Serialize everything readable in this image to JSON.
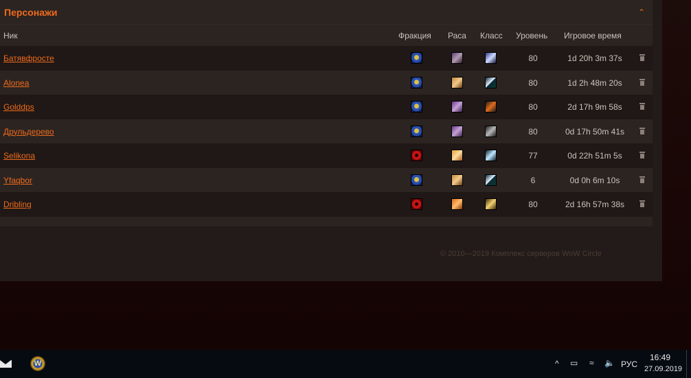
{
  "panel": {
    "title": "Персонажи",
    "collapse_icon": "chevron-up-icon",
    "accent_color": "#ef6a1c"
  },
  "table": {
    "columns": {
      "nick": "Ник",
      "faction": "Фракция",
      "race": "Раса",
      "class": "Класс",
      "level": "Уровень",
      "playtime": "Игровое время"
    },
    "rows": [
      {
        "nick": "Батявфросте",
        "faction": "alliance",
        "race": "race-a",
        "class": "class-a",
        "level": "80",
        "playtime": "1d 20h 3m 37s"
      },
      {
        "nick": "Alonea",
        "faction": "alliance",
        "race": "race-b",
        "class": "class-b",
        "level": "80",
        "playtime": "1d 2h 48m 20s"
      },
      {
        "nick": "Golddps",
        "faction": "alliance",
        "race": "race-c",
        "class": "class-c",
        "level": "80",
        "playtime": "2d 17h 9m 58s"
      },
      {
        "nick": "Друльдерево",
        "faction": "alliance",
        "race": "race-c",
        "class": "class-d",
        "level": "80",
        "playtime": "0d 17h 50m 41s"
      },
      {
        "nick": "Selikona",
        "faction": "horde",
        "race": "race-d",
        "class": "class-e",
        "level": "77",
        "playtime": "0d 22h 51m 5s"
      },
      {
        "nick": "Yfaqbor",
        "faction": "alliance",
        "race": "race-b",
        "class": "class-b",
        "level": "6",
        "playtime": "0d 0h 6m 10s"
      },
      {
        "nick": "Dribling",
        "faction": "horde",
        "race": "race-e",
        "class": "class-f",
        "level": "80",
        "playtime": "2d 16h 57m 38s"
      }
    ],
    "delete_icon": "trash-icon"
  },
  "footer": {
    "copyright": "© 2010—2019 Комплекс серверов WoW Circle"
  },
  "taskbar": {
    "language": "РУС",
    "time": "16:49",
    "date": "27.09.2019",
    "wow_glyph": "W",
    "tray_chevron": "^",
    "tray_icons": [
      "mail-icon",
      "wow-launcher-icon",
      "chevron-up-icon",
      "battery-icon",
      "network-icon",
      "volume-icon"
    ]
  }
}
